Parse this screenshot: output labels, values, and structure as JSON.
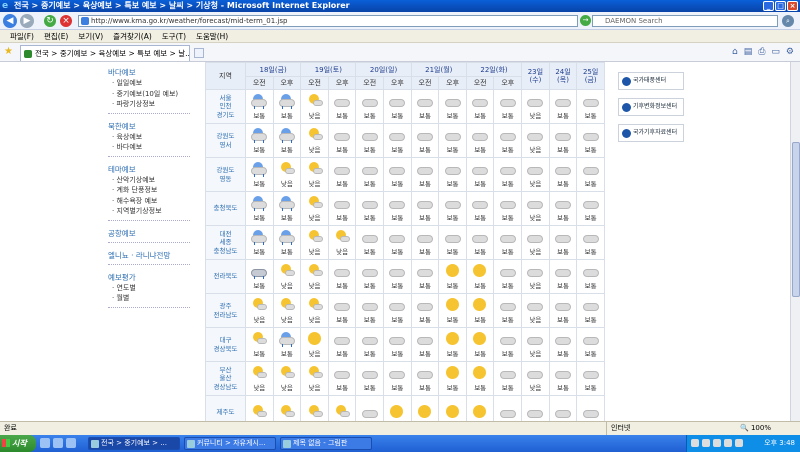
{
  "window": {
    "title": "전국 > 중기예보 > 육상예보 > 특보 예보 > 날씨 > 기상청 - Microsoft Internet Explorer"
  },
  "address": {
    "url": "http://www.kma.go.kr/weather/forecast/mid-term_01.jsp",
    "search_placeholder": "DAEMON Search"
  },
  "menu": [
    "파일(F)",
    "편집(E)",
    "보기(V)",
    "즐겨찾기(A)",
    "도구(T)",
    "도움말(H)"
  ],
  "tab": {
    "label": "전국 > 중기예보 > 육상예보 > 특보 예보 > 날..."
  },
  "sidebar": [
    {
      "title": "바다예보",
      "items": [
        "일일예보",
        "중기예보(10일 예보)",
        "파랑기상정보"
      ]
    },
    {
      "title": "북한예보",
      "items": [
        "육상예보",
        "바다예보"
      ]
    },
    {
      "title": "테마예보",
      "items": [
        "산악기상예보",
        "계화 단풍정보",
        "해수욕장 예보",
        "지역별기상정보"
      ]
    },
    {
      "title": "공항예보",
      "items": []
    },
    {
      "title": "엘니뇨 · 라니냐전망",
      "items": []
    },
    {
      "title": "예보평가",
      "items": [
        "연도별",
        "월별"
      ]
    }
  ],
  "forecast": {
    "region_header": "지역",
    "days": [
      {
        "label": "18일(금)",
        "split": true
      },
      {
        "label": "19일(토)",
        "split": true
      },
      {
        "label": "20일(일)",
        "split": true
      },
      {
        "label": "21일(월)",
        "split": true
      },
      {
        "label": "22일(화)",
        "split": true
      },
      {
        "label": "23일\n(수)",
        "split": false
      },
      {
        "label": "24일\n(목)",
        "split": false
      },
      {
        "label": "25일\n(금)",
        "split": false
      }
    ],
    "am": "오전",
    "pm": "오후",
    "rows": [
      {
        "region": "서울\n인천\n경기도",
        "cells": [
          [
            "shower",
            "보통"
          ],
          [
            "shower",
            "보통"
          ],
          [
            "few",
            "낮음"
          ],
          [
            "cloudy",
            "보통"
          ],
          [
            "cloudy",
            "보통"
          ],
          [
            "cloudy",
            "보통"
          ],
          [
            "cloudy",
            "보통"
          ],
          [
            "cloudy",
            "보통"
          ],
          [
            "cloudy",
            "보통"
          ],
          [
            "cloudy",
            "보통"
          ],
          [
            "cloudy",
            "낮음"
          ],
          [
            "cloudy",
            "보통"
          ],
          [
            "cloudy",
            "보통"
          ]
        ]
      },
      {
        "region": "강원도\n영서",
        "cells": [
          [
            "shower",
            "보통"
          ],
          [
            "shower",
            "보통"
          ],
          [
            "few",
            "낮음"
          ],
          [
            "cloudy",
            "보통"
          ],
          [
            "cloudy",
            "보통"
          ],
          [
            "cloudy",
            "보통"
          ],
          [
            "cloudy",
            "보통"
          ],
          [
            "cloudy",
            "보통"
          ],
          [
            "cloudy",
            "보통"
          ],
          [
            "cloudy",
            "보통"
          ],
          [
            "cloudy",
            "낮음"
          ],
          [
            "cloudy",
            "보통"
          ],
          [
            "cloudy",
            "보통"
          ]
        ]
      },
      {
        "region": "강원도\n영동",
        "cells": [
          [
            "shower",
            "보통"
          ],
          [
            "few",
            "낮음"
          ],
          [
            "few",
            "낮음"
          ],
          [
            "cloudy",
            "보통"
          ],
          [
            "cloudy",
            "보통"
          ],
          [
            "cloudy",
            "보통"
          ],
          [
            "cloudy",
            "보통"
          ],
          [
            "cloudy",
            "보통"
          ],
          [
            "cloudy",
            "보통"
          ],
          [
            "cloudy",
            "보통"
          ],
          [
            "cloudy",
            "낮음"
          ],
          [
            "cloudy",
            "보통"
          ],
          [
            "cloudy",
            "보통"
          ]
        ]
      },
      {
        "region": "충청북도",
        "cells": [
          [
            "shower",
            "보통"
          ],
          [
            "shower",
            "보통"
          ],
          [
            "few",
            "낮음"
          ],
          [
            "cloudy",
            "보통"
          ],
          [
            "cloudy",
            "보통"
          ],
          [
            "cloudy",
            "보통"
          ],
          [
            "cloudy",
            "보통"
          ],
          [
            "cloudy",
            "보통"
          ],
          [
            "cloudy",
            "보통"
          ],
          [
            "cloudy",
            "보통"
          ],
          [
            "cloudy",
            "낮음"
          ],
          [
            "cloudy",
            "보통"
          ],
          [
            "cloudy",
            "보통"
          ]
        ]
      },
      {
        "region": "대전\n세종\n충청남도",
        "cells": [
          [
            "shower",
            "보통"
          ],
          [
            "shower",
            "보통"
          ],
          [
            "few",
            "낮음"
          ],
          [
            "few",
            "낮음"
          ],
          [
            "cloudy",
            "보통"
          ],
          [
            "cloudy",
            "보통"
          ],
          [
            "cloudy",
            "보통"
          ],
          [
            "cloudy",
            "보통"
          ],
          [
            "cloudy",
            "보통"
          ],
          [
            "cloudy",
            "보통"
          ],
          [
            "cloudy",
            "낮음"
          ],
          [
            "cloudy",
            "보통"
          ],
          [
            "cloudy",
            "보통"
          ]
        ]
      },
      {
        "region": "전라북도",
        "cells": [
          [
            "rain",
            "보통"
          ],
          [
            "few",
            "낮음"
          ],
          [
            "few",
            "낮음"
          ],
          [
            "cloudy",
            "보통"
          ],
          [
            "cloudy",
            "보통"
          ],
          [
            "cloudy",
            "보통"
          ],
          [
            "cloudy",
            "보통"
          ],
          [
            "sunny",
            "보통"
          ],
          [
            "sunny",
            "보통"
          ],
          [
            "cloudy",
            "보통"
          ],
          [
            "cloudy",
            "낮음"
          ],
          [
            "cloudy",
            "보통"
          ],
          [
            "cloudy",
            "보통"
          ]
        ]
      },
      {
        "region": "광주\n전라남도",
        "cells": [
          [
            "few",
            "낮음"
          ],
          [
            "few",
            "낮음"
          ],
          [
            "few",
            "낮음"
          ],
          [
            "cloudy",
            "보통"
          ],
          [
            "cloudy",
            "보통"
          ],
          [
            "cloudy",
            "보통"
          ],
          [
            "cloudy",
            "보통"
          ],
          [
            "sunny",
            "보통"
          ],
          [
            "sunny",
            "보통"
          ],
          [
            "cloudy",
            "보통"
          ],
          [
            "cloudy",
            "낮음"
          ],
          [
            "cloudy",
            "보통"
          ],
          [
            "cloudy",
            "보통"
          ]
        ]
      },
      {
        "region": "대구\n경상북도",
        "cells": [
          [
            "few",
            "보통"
          ],
          [
            "shower",
            "보통"
          ],
          [
            "sunny",
            "낮음"
          ],
          [
            "cloudy",
            "보통"
          ],
          [
            "cloudy",
            "보통"
          ],
          [
            "cloudy",
            "보통"
          ],
          [
            "cloudy",
            "보통"
          ],
          [
            "sunny",
            "보통"
          ],
          [
            "sunny",
            "보통"
          ],
          [
            "cloudy",
            "보통"
          ],
          [
            "cloudy",
            "낮음"
          ],
          [
            "cloudy",
            "보통"
          ],
          [
            "cloudy",
            "보통"
          ]
        ]
      },
      {
        "region": "부산\n울산\n경상남도",
        "cells": [
          [
            "few",
            "낮음"
          ],
          [
            "few",
            "낮음"
          ],
          [
            "few",
            "낮음"
          ],
          [
            "cloudy",
            "보통"
          ],
          [
            "cloudy",
            "보통"
          ],
          [
            "cloudy",
            "보통"
          ],
          [
            "cloudy",
            "보통"
          ],
          [
            "sunny",
            "보통"
          ],
          [
            "sunny",
            "보통"
          ],
          [
            "cloudy",
            "보통"
          ],
          [
            "cloudy",
            "낮음"
          ],
          [
            "cloudy",
            "보통"
          ],
          [
            "cloudy",
            "보통"
          ]
        ]
      },
      {
        "region": "제주도",
        "cells": [
          [
            "few",
            ""
          ],
          [
            "few",
            ""
          ],
          [
            "few",
            ""
          ],
          [
            "few",
            ""
          ],
          [
            "cloudy",
            ""
          ],
          [
            "sunny",
            ""
          ],
          [
            "sunny",
            ""
          ],
          [
            "sunny",
            ""
          ],
          [
            "sunny",
            ""
          ],
          [
            "cloudy",
            ""
          ],
          [
            "cloudy",
            ""
          ],
          [
            "cloudy",
            ""
          ],
          [
            "cloudy",
            ""
          ]
        ]
      }
    ]
  },
  "right_links": [
    "국가태풍센터",
    "기후변화정보센터",
    "국가기후자료센터"
  ],
  "status": {
    "left": "완료",
    "zone": "인터넷",
    "zoom": "100%"
  },
  "taskbar": {
    "start": "시작",
    "tasks": [
      "전국 > 중기예보 > ...",
      "커뮤니티 > 자유게시...",
      "제목 없음 - 그림판"
    ],
    "clock": "오후 3:48"
  },
  "icon_names": [
    "ie-logo-icon",
    "back-icon",
    "forward-icon",
    "refresh-icon",
    "stop-icon",
    "star-icon",
    "home-icon",
    "print-icon",
    "page-icon",
    "tools-icon"
  ]
}
